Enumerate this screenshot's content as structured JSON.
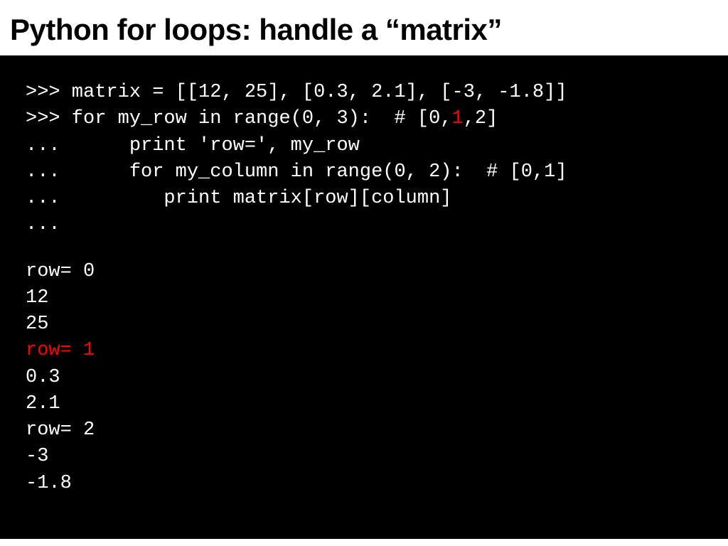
{
  "title": "Python for loops: handle a “matrix”",
  "code": {
    "l1": ">>> matrix = [[12, 25], [0.3, 2.1], [-3, -1.8]]",
    "l2a": ">>> for my_row in range(0, 3):  # [0,",
    "l2_hl": "1",
    "l2b": ",2]",
    "l3": "...      print 'row=', my_row",
    "l4": "...      for my_column in range(0, 2):  # [0,1]",
    "l5": "...         print matrix[row][column]",
    "l6": "..."
  },
  "output": {
    "r0": "row= 0",
    "v1": "12",
    "v2": "25",
    "r1": "row= 1",
    "v3": "0.3",
    "v4": "2.1",
    "r2": "row= 2",
    "v5": "-3",
    "v6": "-1.8"
  }
}
